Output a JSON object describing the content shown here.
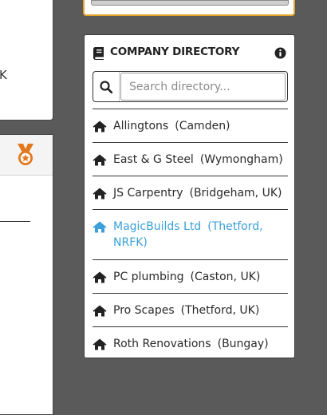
{
  "left_fragment": {
    "text": "K"
  },
  "colors": {
    "medal": "#e2791f",
    "accent_link": "#3aa0d6",
    "page_bg": "#5a5a5a",
    "top_widget_border": "#e2a52a"
  },
  "icons": {
    "medal": "medal-icon",
    "book": "book-icon",
    "info": "info-icon",
    "search": "search-icon",
    "home": "home-icon"
  },
  "directory": {
    "title": "COMPANY DIRECTORY",
    "search": {
      "placeholder": "Search directory...",
      "value": ""
    },
    "items": [
      {
        "name": "Allingtons",
        "location": "(Camden)",
        "active": false
      },
      {
        "name": "East & G Steel",
        "location": "(Wymongham)",
        "active": false
      },
      {
        "name": "JS Carpentry",
        "location": "(Bridgeham, UK)",
        "active": false
      },
      {
        "name": "MagicBuilds Ltd",
        "location": "(Thetford, NRFK)",
        "active": true
      },
      {
        "name": "PC plumbing",
        "location": "(Caston, UK)",
        "active": false
      },
      {
        "name": "Pro Scapes",
        "location": "(Thetford, UK)",
        "active": false
      },
      {
        "name": "Roth Renovations",
        "location": "(Bungay)",
        "active": false
      }
    ]
  }
}
